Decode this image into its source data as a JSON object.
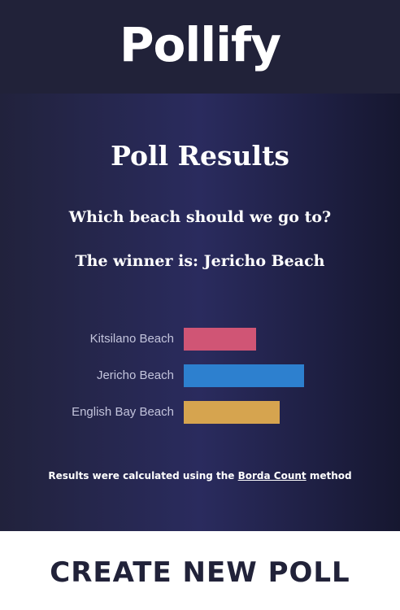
{
  "header": {
    "logo_text": "Pollify"
  },
  "results": {
    "title": "Poll Results",
    "question": "Which beach should we go to?",
    "winner_text": "The winner is: Jericho Beach"
  },
  "chart_data": {
    "type": "bar",
    "orientation": "horizontal",
    "categories": [
      "Kitsilano Beach",
      "Jericho Beach",
      "English Bay Beach"
    ],
    "values": [
      3,
      5,
      4
    ],
    "colors": [
      "#d05575",
      "#2d80cf",
      "#d6a44f"
    ],
    "xlim": [
      0,
      5
    ],
    "grid": false,
    "legend": "none"
  },
  "footnote": {
    "prefix": "Results were calculated using the ",
    "link_text": "Borda Count",
    "suffix": " method"
  },
  "cta": {
    "label": "CREATE NEW POLL"
  }
}
